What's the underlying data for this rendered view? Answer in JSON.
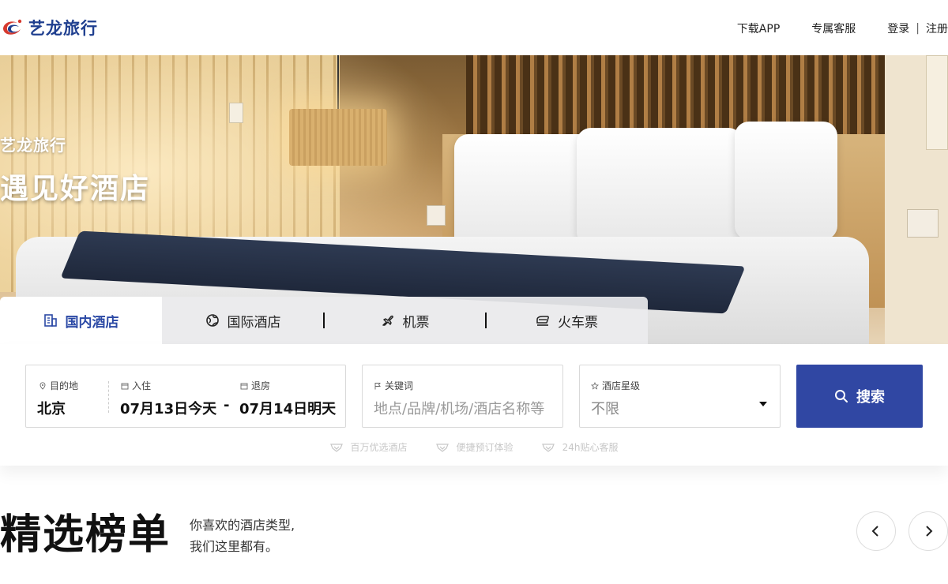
{
  "header": {
    "logo_text": "艺龙旅行",
    "nav": {
      "download_app": "下载APP",
      "service": "专属客服",
      "login": "登录",
      "separator": "|",
      "register": "注册"
    }
  },
  "hero": {
    "slogan_small": "艺龙旅行",
    "slogan_big": "遇见好酒店"
  },
  "tabs": [
    {
      "label": "国内酒店",
      "icon": "building-icon",
      "active": true
    },
    {
      "label": "国际酒店",
      "icon": "globe-icon",
      "active": false
    },
    {
      "label": "机票",
      "icon": "plane-icon",
      "active": false
    },
    {
      "label": "火车票",
      "icon": "train-icon",
      "active": false
    }
  ],
  "search": {
    "destination_label": "目的地",
    "destination_value": "北京",
    "checkin_label": "入住",
    "checkin_value": "07月13日今天",
    "date_separator": "-",
    "checkout_label": "退房",
    "checkout_value": "07月14日明天",
    "keyword_label": "关键词",
    "keyword_placeholder": "地点/品牌/机场/酒店名称等",
    "star_label": "酒店星级",
    "star_value": "不限",
    "button_label": "搜索"
  },
  "features": [
    "百万优选酒店",
    "便捷预订体验",
    "24h贴心客服"
  ],
  "section": {
    "title": "精选榜单",
    "subtitle_line1": "你喜欢的酒店类型,",
    "subtitle_line2": "我们这里都有。"
  },
  "colors": {
    "brand_blue": "#3047a3",
    "logo_blue": "#1f3f8f",
    "logo_red": "#d63a2f",
    "active_tab_text": "#2b49a5"
  }
}
